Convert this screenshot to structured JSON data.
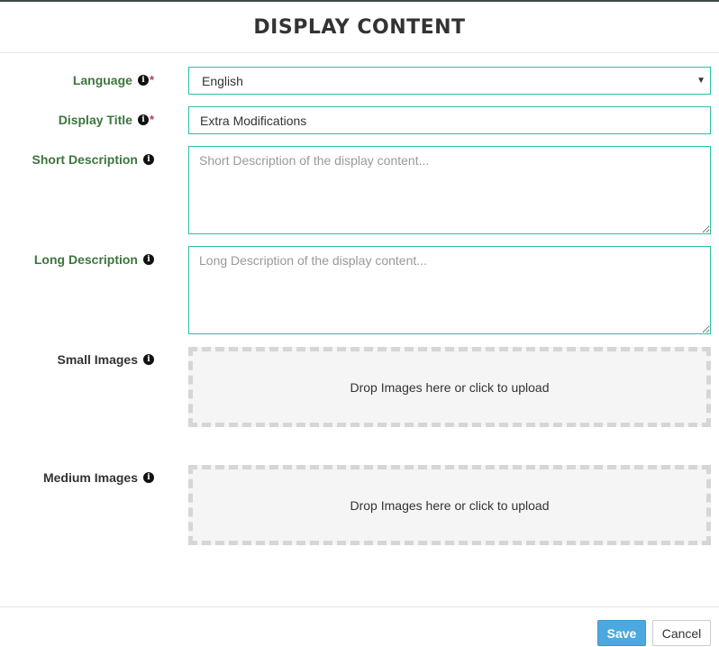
{
  "modal": {
    "title": "DISPLAY CONTENT"
  },
  "form": {
    "language": {
      "label": "Language",
      "required_mark": "*",
      "value": "English"
    },
    "display_title": {
      "label": "Display Title",
      "required_mark": "*",
      "value": "Extra Modifications"
    },
    "short_description": {
      "label": "Short Description",
      "placeholder": "Short Description of the display content..."
    },
    "long_description": {
      "label": "Long Description",
      "placeholder": "Long Description of the display content..."
    },
    "small_images": {
      "label": "Small Images",
      "dropzone_text": "Drop Images here or click to upload"
    },
    "medium_images": {
      "label": "Medium Images",
      "dropzone_text": "Drop Images here or click to upload"
    }
  },
  "footer": {
    "save_label": "Save",
    "cancel_label": "Cancel"
  },
  "icons": {
    "info": "info-circle-icon",
    "caret": "chevron-down-icon"
  },
  "colors": {
    "label_green": "#3c763d",
    "input_border": "#2bbfa9",
    "required": "#a94442",
    "save_button": "#4da9dd"
  }
}
